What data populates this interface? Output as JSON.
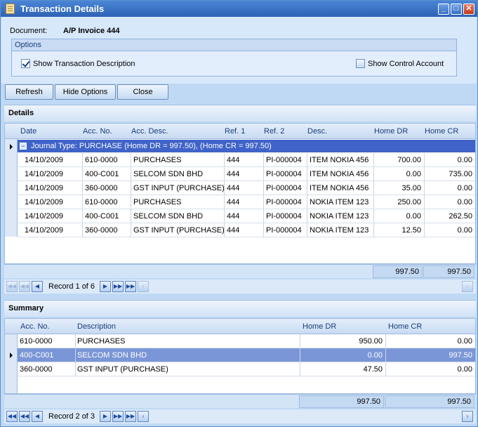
{
  "window": {
    "title": "Transaction Details"
  },
  "document": {
    "label": "Document:",
    "value": "A/P Invoice 444"
  },
  "options": {
    "group_title": "Options",
    "show_description": {
      "label": "Show Transaction Description",
      "checked": true
    },
    "show_control": {
      "label": "Show Control Account",
      "checked": false
    }
  },
  "buttons": {
    "refresh": "Refresh",
    "hide_options": "Hide Options",
    "close": "Close"
  },
  "details": {
    "title": "Details",
    "columns": [
      "Date",
      "Acc. No.",
      "Acc. Desc.",
      "Ref. 1",
      "Ref. 2",
      "Desc.",
      "Home DR",
      "Home CR"
    ],
    "group_row": "Journal Type: PURCHASE (Home DR = 997.50), (Home CR = 997.50)",
    "rows": [
      [
        "14/10/2009",
        "610-0000",
        "PURCHASES",
        "444",
        "PI-000004",
        "ITEM NOKIA 456",
        "700.00",
        "0.00"
      ],
      [
        "14/10/2009",
        "400-C001",
        "SELCOM SDN BHD",
        "444",
        "PI-000004",
        "ITEM NOKIA 456",
        "0.00",
        "735.00"
      ],
      [
        "14/10/2009",
        "360-0000",
        "GST INPUT (PURCHASE)",
        "444",
        "PI-000004",
        "ITEM NOKIA 456",
        "35.00",
        "0.00"
      ],
      [
        "14/10/2009",
        "610-0000",
        "PURCHASES",
        "444",
        "PI-000004",
        "NOKIA ITEM 123",
        "250.00",
        "0.00"
      ],
      [
        "14/10/2009",
        "400-C001",
        "SELCOM SDN BHD",
        "444",
        "PI-000004",
        "NOKIA ITEM 123",
        "0.00",
        "262.50"
      ],
      [
        "14/10/2009",
        "360-0000",
        "GST INPUT (PURCHASE)",
        "444",
        "PI-000004",
        "NOKIA ITEM 123",
        "12.50",
        "0.00"
      ]
    ],
    "total_dr": "997.50",
    "total_cr": "997.50",
    "record_text": "Record 1 of 6"
  },
  "summary": {
    "title": "Summary",
    "columns": [
      "Acc. No.",
      "Description",
      "Home DR",
      "Home CR"
    ],
    "rows": [
      [
        "610-0000",
        "PURCHASES",
        "950.00",
        "0.00"
      ],
      [
        "400-C001",
        "SELCOM SDN BHD",
        "0.00",
        "997.50"
      ],
      [
        "360-0000",
        "GST INPUT (PURCHASE)",
        "47.50",
        "0.00"
      ]
    ],
    "selected_row": 1,
    "total_dr": "997.50",
    "total_cr": "997.50",
    "record_text": "Record 2 of 3"
  },
  "colors": {
    "title_bar": "#3a72c4",
    "selection": "#7a96d6",
    "group_row": "#3f63c8"
  }
}
